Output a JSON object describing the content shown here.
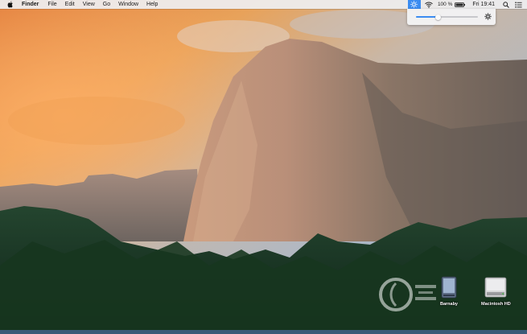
{
  "menubar": {
    "app_name": "Finder",
    "menus": [
      "File",
      "Edit",
      "View",
      "Go",
      "Window",
      "Help"
    ],
    "battery_percent": "100 %",
    "clock": "Fri 19:41"
  },
  "brightness": {
    "level": 0.36
  },
  "drives": [
    {
      "label": "Barnaby"
    },
    {
      "label": "Macintosh HD"
    }
  ],
  "colors": {
    "accent": "#3b8cf1"
  }
}
